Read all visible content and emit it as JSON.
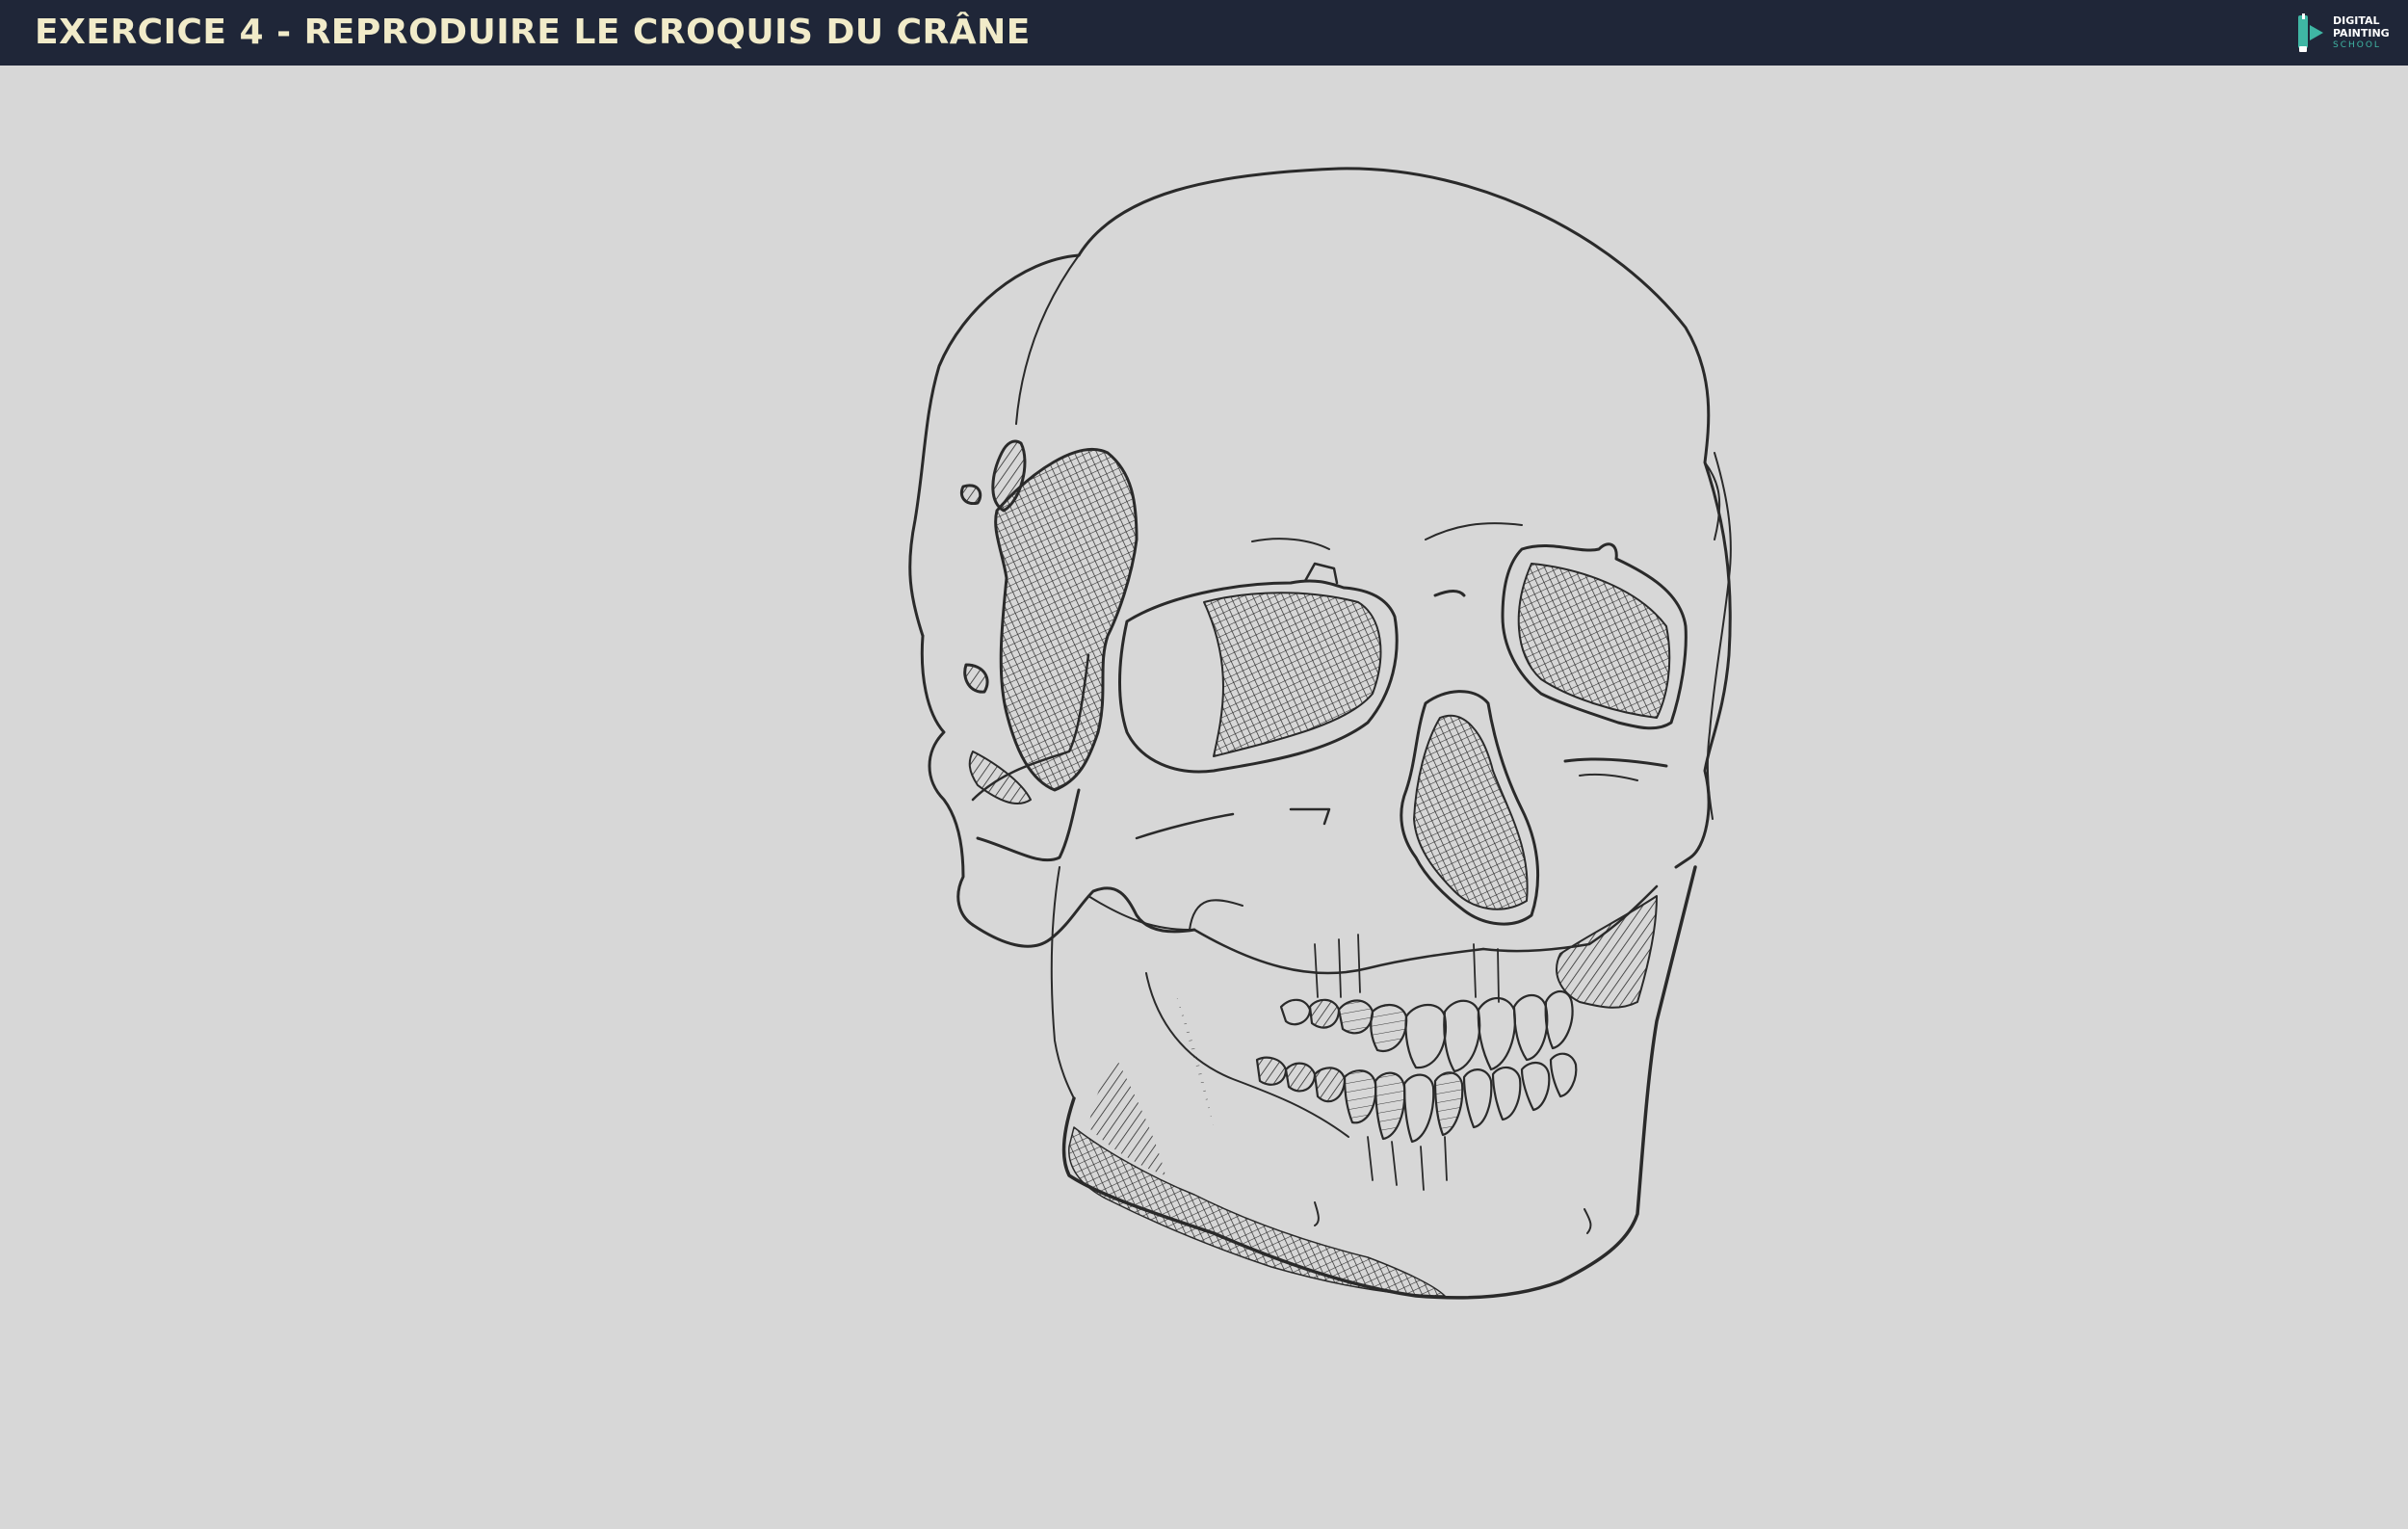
{
  "header": {
    "title": "EXERCICE 4 - REPRODUIRE LE CROQUIS DU CRÂNE",
    "background_color": "#1f2638",
    "title_color": "#f1ebc9"
  },
  "logo": {
    "line1": "DIGITAL",
    "line2": "PAINTING",
    "line3": "SCHOOL",
    "accent_color": "#3fb6a4"
  },
  "canvas": {
    "background_color": "#d7d7d7",
    "ink_color": "#2a2a2a",
    "illustration": "skull-sketch"
  }
}
